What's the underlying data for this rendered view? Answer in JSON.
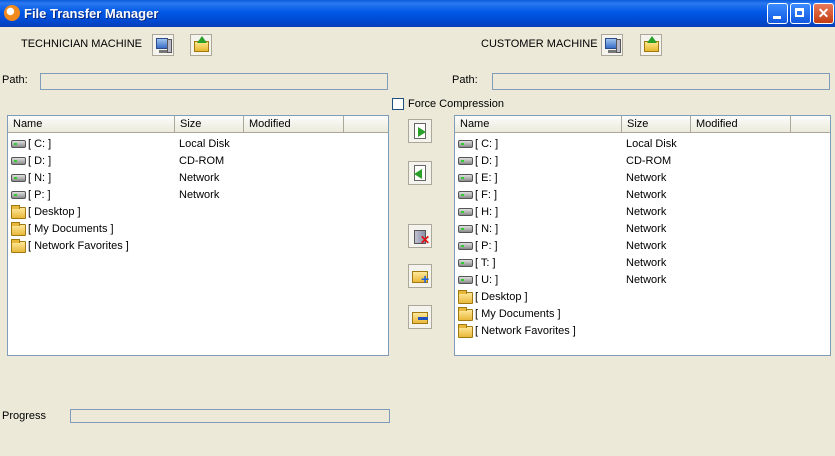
{
  "window": {
    "title": "File Transfer Manager"
  },
  "technician": {
    "label": "TECHNICIAN MACHINE",
    "path_label": "Path:",
    "path_value": ""
  },
  "customer": {
    "label": "CUSTOMER MACHINE",
    "path_label": "Path:",
    "path_value": ""
  },
  "force_compression": {
    "label": "Force Compression",
    "checked": false
  },
  "columns": [
    "Name",
    "Size",
    "Modified"
  ],
  "left_items": [
    {
      "name": "[ C: ]",
      "size": "Local Disk",
      "icon": "drive-icon"
    },
    {
      "name": "[ D: ]",
      "size": "CD-ROM",
      "icon": "drive-icon"
    },
    {
      "name": "[ N: ]",
      "size": "Network",
      "icon": "drive-icon"
    },
    {
      "name": "[ P: ]",
      "size": "Network",
      "icon": "drive-icon"
    },
    {
      "name": "[ Desktop ]",
      "size": "",
      "icon": "folder-icon"
    },
    {
      "name": "[ My Documents ]",
      "size": "",
      "icon": "folder-icon"
    },
    {
      "name": "[ Network Favorites ]",
      "size": "",
      "icon": "folder-icon"
    }
  ],
  "right_items": [
    {
      "name": "[ C: ]",
      "size": "Local Disk",
      "icon": "drive-icon"
    },
    {
      "name": "[ D: ]",
      "size": "CD-ROM",
      "icon": "drive-icon"
    },
    {
      "name": "[ E: ]",
      "size": "Network",
      "icon": "drive-icon"
    },
    {
      "name": "[ F: ]",
      "size": "Network",
      "icon": "drive-icon"
    },
    {
      "name": "[ H: ]",
      "size": "Network",
      "icon": "drive-icon"
    },
    {
      "name": "[ N: ]",
      "size": "Network",
      "icon": "drive-icon"
    },
    {
      "name": "[ P: ]",
      "size": "Network",
      "icon": "drive-icon"
    },
    {
      "name": "[ T: ]",
      "size": "Network",
      "icon": "drive-icon"
    },
    {
      "name": "[ U: ]",
      "size": "Network",
      "icon": "drive-icon"
    },
    {
      "name": "[ Desktop ]",
      "size": "",
      "icon": "folder-icon"
    },
    {
      "name": "[ My Documents ]",
      "size": "",
      "icon": "folder-icon"
    },
    {
      "name": "[ Network Favorites ]",
      "size": "",
      "icon": "folder-icon"
    }
  ],
  "progress": {
    "label": "Progress",
    "value": 0
  },
  "colors": {
    "titlebar": "#0058e6",
    "window_bg": "#ece9d8",
    "field_border": "#7f9db9"
  }
}
